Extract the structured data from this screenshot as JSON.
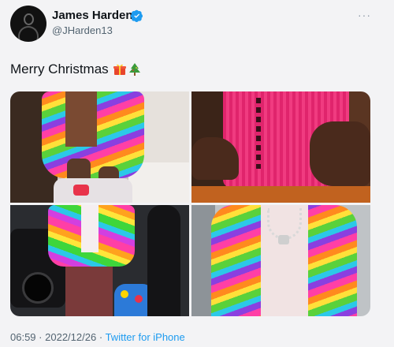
{
  "author": {
    "display_name": "James Harden",
    "handle": "@JHarden13",
    "verified": true
  },
  "tweet": {
    "text": "Merry Christmas",
    "emojis": [
      "gift-emoji",
      "christmas-tree-emoji"
    ],
    "photo_count": 4
  },
  "meta": {
    "time": "06:59",
    "separator": "·",
    "date": "2022/12/26",
    "source": "Twitter for iPhone"
  },
  "colors": {
    "link": "#1d9bf0",
    "verified_badge": "#1d9bf0",
    "secondary_text": "#536471"
  }
}
